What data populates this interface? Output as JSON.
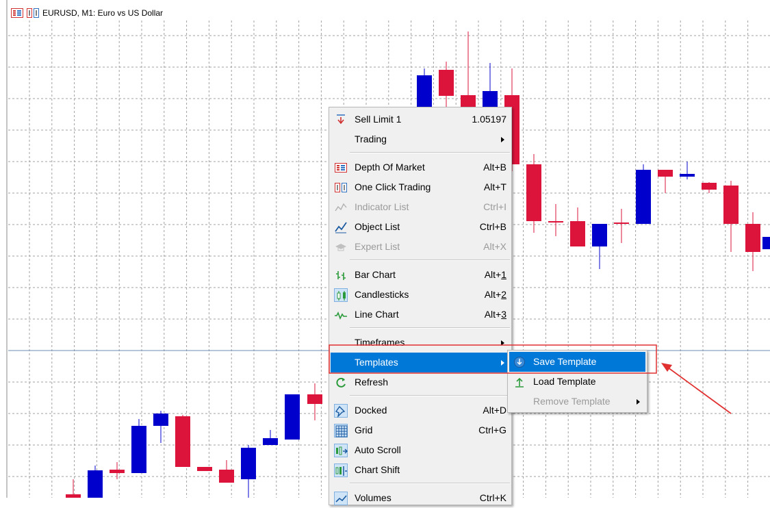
{
  "chart": {
    "symbol_label": "EURUSD, M1:  Euro vs US Dollar",
    "colors": {
      "bull": "#0000cd",
      "bear": "#dc143c",
      "grid": "#a0a0a0",
      "wick": "#333333"
    }
  },
  "context_menu": {
    "items": [
      {
        "label": "Sell Limit 1",
        "shortcut": "1.05197",
        "icon": "sell-limit-icon"
      },
      {
        "label": "Trading",
        "submenu": true
      },
      {
        "label": "Depth Of Market",
        "shortcut": "Alt+B",
        "icon": "depth-of-market-icon"
      },
      {
        "label": "One Click Trading",
        "shortcut": "Alt+T",
        "icon": "one-click-trading-icon"
      },
      {
        "label": "Indicator List",
        "shortcut": "Ctrl+I",
        "icon": "indicator-list-icon",
        "disabled": true
      },
      {
        "label": "Object List",
        "shortcut": "Ctrl+B",
        "icon": "object-list-icon"
      },
      {
        "label": "Expert List",
        "shortcut": "Alt+X",
        "icon": "expert-list-icon",
        "disabled": true
      },
      {
        "label": "Bar Chart",
        "shortcut": "Alt+1",
        "icon": "bar-chart-icon"
      },
      {
        "label": "Candlesticks",
        "shortcut": "Alt+2",
        "icon": "candlesticks-icon",
        "checked": true
      },
      {
        "label": "Line Chart",
        "shortcut": "Alt+3",
        "icon": "line-chart-icon"
      },
      {
        "label": "Timeframes",
        "submenu": true
      },
      {
        "label": "Templates",
        "submenu": true,
        "selected": true
      },
      {
        "label": "Refresh",
        "icon": "refresh-icon"
      },
      {
        "label": "Docked",
        "shortcut": "Alt+D",
        "icon": "docked-icon",
        "checked": true
      },
      {
        "label": "Grid",
        "shortcut": "Ctrl+G",
        "icon": "grid-icon",
        "checked": true
      },
      {
        "label": "Auto Scroll",
        "icon": "auto-scroll-icon",
        "checked": true
      },
      {
        "label": "Chart Shift",
        "icon": "chart-shift-icon",
        "checked": true
      },
      {
        "label": "Volumes",
        "shortcut": "Ctrl+K",
        "icon": "volumes-icon",
        "checked": true
      }
    ]
  },
  "templates_submenu": {
    "items": [
      {
        "label": "Save Template",
        "icon": "save-template-icon",
        "selected": true
      },
      {
        "label": "Load Template",
        "icon": "load-template-icon"
      },
      {
        "label": "Remove Template",
        "submenu": true,
        "disabled": true
      }
    ]
  },
  "annotation": {
    "highlight_color": "#e03030"
  }
}
